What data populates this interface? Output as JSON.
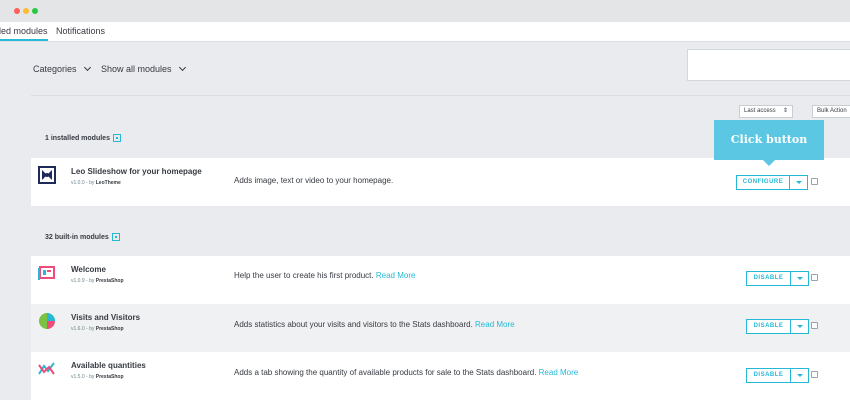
{
  "window": {
    "controls": [
      "close",
      "minimize",
      "maximize"
    ]
  },
  "tabs": [
    {
      "label": "led modules",
      "active": true
    },
    {
      "label": "Notifications",
      "active": false
    }
  ],
  "filters": {
    "categories_label": "Categories",
    "show_label": "Show all modules"
  },
  "toolbar": {
    "sort_value": "Last access",
    "bulk_label": "Bulk Action"
  },
  "sections": {
    "installed_title": "1 installed modules",
    "builtin_title": "32 built-in modules"
  },
  "installed_modules": [
    {
      "name": "Leo Slideshow for your homepage",
      "version": "v1.0.0 - by",
      "author": "LeoTheme",
      "description": "Adds image, text or video to your homepage.",
      "read_more": "",
      "action_label": "CONFIGURE",
      "icon": "leo-slideshow-icon"
    }
  ],
  "builtin_modules": [
    {
      "name": "Welcome",
      "version": "v1.0.9 - by",
      "author": "PrestaShop",
      "description": "Help the user to create his first product.",
      "read_more": "Read More",
      "action_label": "DISABLE",
      "icon": "welcome-icon"
    },
    {
      "name": "Visits and Visitors",
      "version": "v1.6.0 - by",
      "author": "PrestaShop",
      "description": "Adds statistics about your visits and visitors to the Stats dashboard.",
      "read_more": "Read More",
      "action_label": "DISABLE",
      "icon": "pie-chart-icon"
    },
    {
      "name": "Available quantities",
      "version": "v1.5.0 - by",
      "author": "PrestaShop",
      "description": "Adds a tab showing the quantity of available products for sale to the Stats dashboard.",
      "read_more": "Read More",
      "action_label": "DISABLE",
      "icon": "line-chart-icon"
    }
  ],
  "tooltip": {
    "text": "Click button"
  },
  "colors": {
    "accent": "#25b9d7",
    "tooltip": "#5bc7e2"
  }
}
